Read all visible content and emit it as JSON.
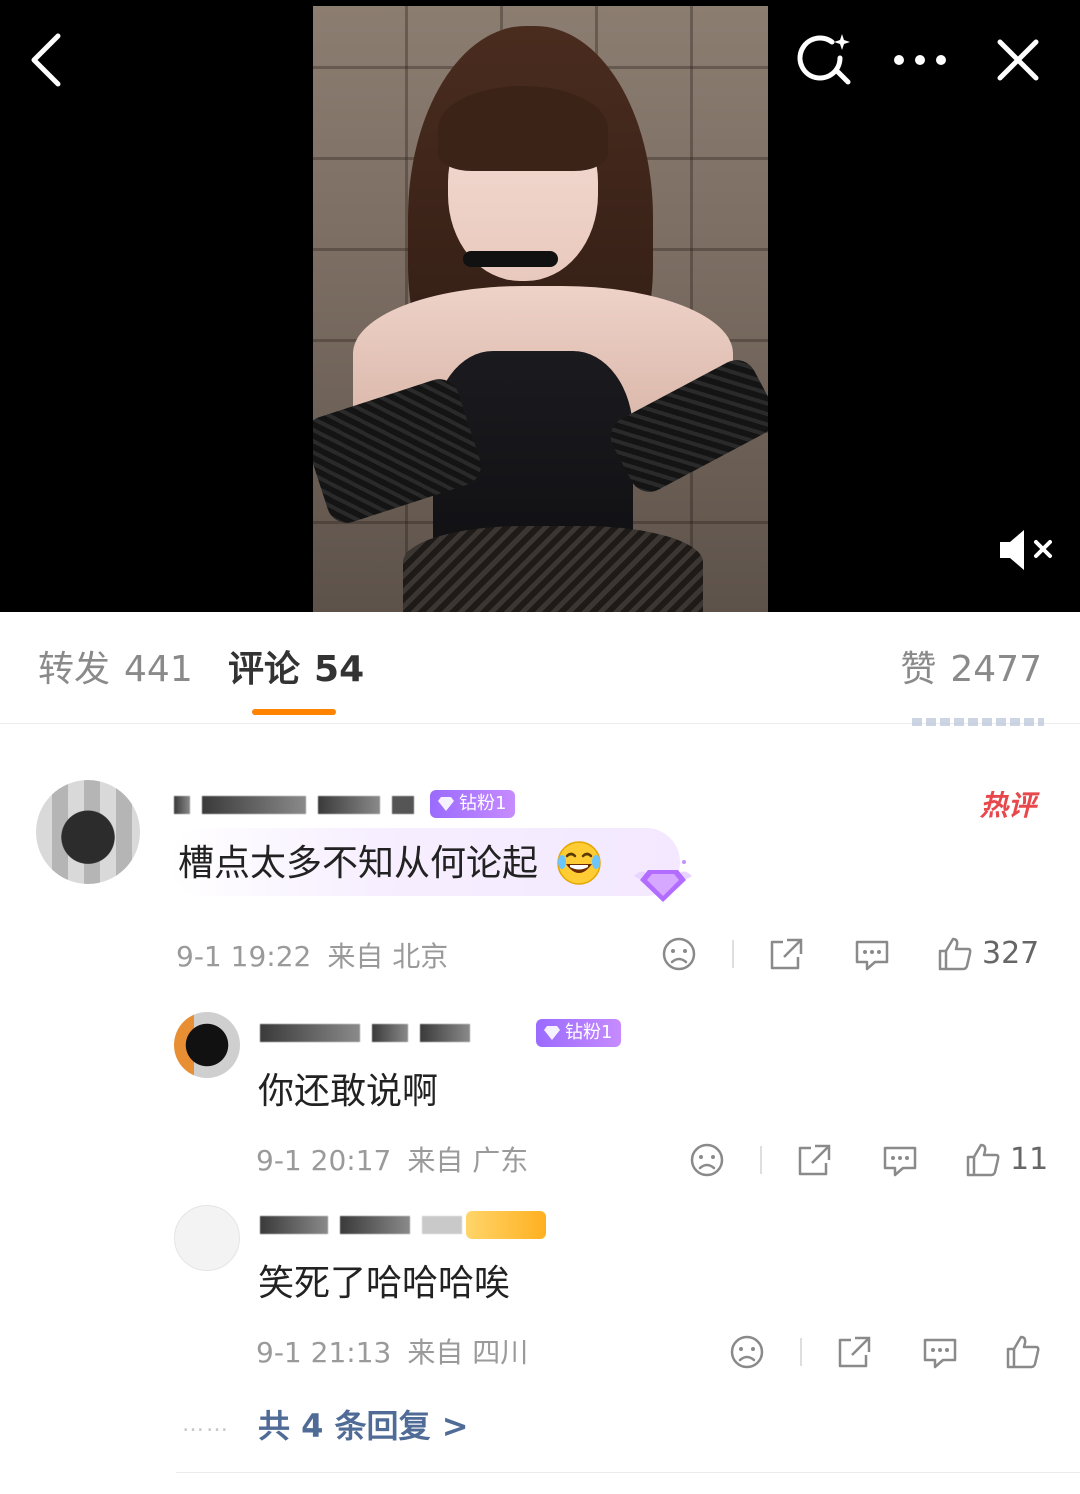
{
  "tabs": {
    "repost": {
      "label": "转发",
      "count": "441"
    },
    "comments": {
      "label": "评论",
      "count": "54"
    },
    "likes": {
      "label": "赞",
      "count": "2477"
    }
  },
  "accent_color": "#ff8200",
  "icons": {
    "back": "chevron-left-icon",
    "search": "search-sparkle-icon",
    "more": "more-dots-icon",
    "close": "close-icon",
    "mute": "speaker-muted-icon"
  },
  "comments": [
    {
      "badge": "钻粉1",
      "hot_tag": "热评",
      "text": "槽点太多不知从何论起",
      "time": "9-1 19:22",
      "location": "来自 北京",
      "likes": "327"
    },
    {
      "badge": "钻粉1",
      "text": "你还敢说啊",
      "time": "9-1 20:17",
      "location": "来自 广东",
      "likes": "11"
    },
    {
      "text": "笑死了哈哈哈唉",
      "time": "9-1 21:13",
      "location": "来自 四川",
      "likes": ""
    }
  ],
  "more_replies": {
    "dots": "……",
    "label": "共 4 条回复 >"
  }
}
